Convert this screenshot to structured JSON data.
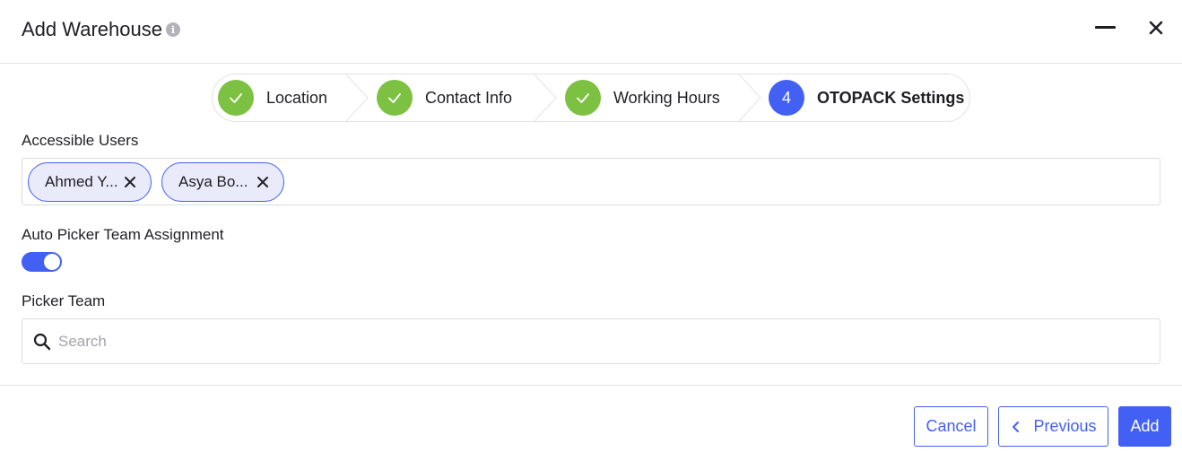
{
  "dialog": {
    "title": "Add Warehouse",
    "info_icon": "i"
  },
  "stepper": {
    "steps": [
      {
        "label": "Location",
        "state": "done",
        "icon": "check-icon"
      },
      {
        "label": "Contact Info",
        "state": "done",
        "icon": "check-icon"
      },
      {
        "label": "Working Hours",
        "state": "done",
        "icon": "check-icon"
      },
      {
        "label": "OTOPACK Settings",
        "state": "active",
        "number": "4"
      }
    ]
  },
  "accessible_users": {
    "label": "Accessible Users",
    "chips": [
      {
        "label": "Ahmed Y..."
      },
      {
        "label": "Asya Bo..."
      }
    ]
  },
  "auto_picker": {
    "label": "Auto Picker Team Assignment",
    "enabled": true
  },
  "picker_team": {
    "label": "Picker Team",
    "placeholder": "Search",
    "value": ""
  },
  "footer": {
    "cancel_label": "Cancel",
    "previous_label": "Previous",
    "add_label": "Add"
  },
  "colors": {
    "accent": "#4360f5",
    "done": "#7cc142",
    "border": "#e3e3e8"
  }
}
